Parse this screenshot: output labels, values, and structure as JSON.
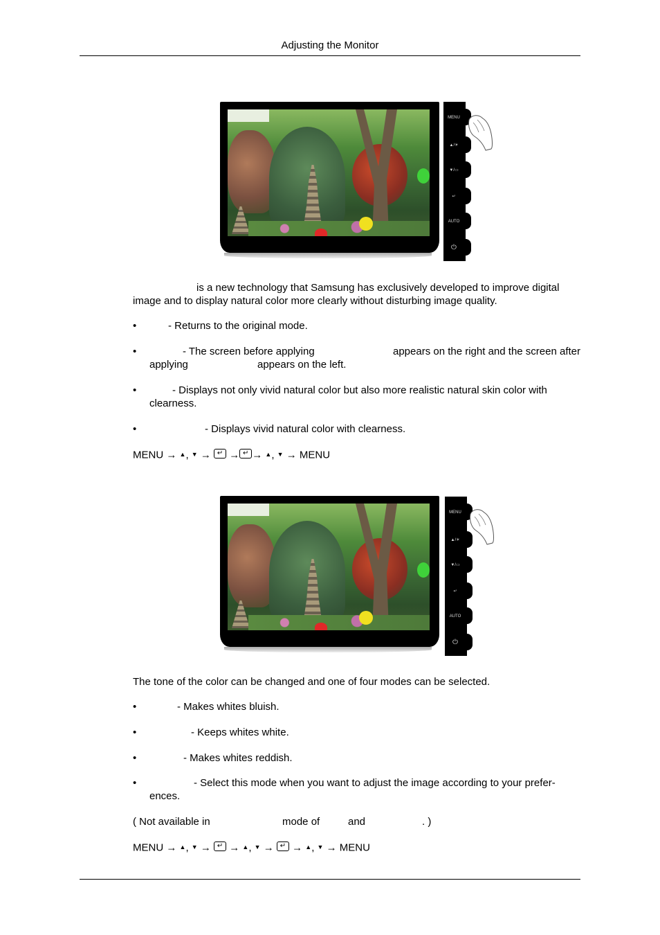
{
  "header": {
    "title": "Adjusting the Monitor"
  },
  "monitor_buttons": [
    {
      "label": "MENU",
      "icon": "menu-icon"
    },
    {
      "label": "▲/☀",
      "icon": "up-brightness-icon"
    },
    {
      "label": "▼/▭",
      "icon": "down-source-icon"
    },
    {
      "label": "↵",
      "icon": "enter-icon"
    },
    {
      "label": "AUTO",
      "icon": "auto-icon"
    },
    {
      "label": "⏻",
      "icon": "power-icon"
    }
  ],
  "section1": {
    "intro_line1": "is a new technology that Samsung has exclusively developed to improve digital",
    "intro_line2": "image and to display natural color more clearly without disturbing image quality.",
    "bullets": [
      {
        "text": "- Returns to the original mode."
      },
      {
        "text_a": "- The screen before applying",
        "text_b": "appears on the right and the screen after",
        "text_c": "applying",
        "text_d": "appears on the left."
      },
      {
        "line1": "- Displays not only vivid natural color but also more realistic natural skin color with",
        "line2": "clearness."
      },
      {
        "text": "- Displays vivid natural color with clearness."
      }
    ],
    "sequence": {
      "menu_start": "MENU",
      "arrow": "→",
      "up": "▲",
      "down": "▼",
      "comma": ",",
      "enter": "↵",
      "menu_end": "MENU"
    }
  },
  "section2": {
    "intro": "The tone of the color can be changed and one of four modes can be selected.",
    "bullets": [
      {
        "text": "- Makes whites bluish."
      },
      {
        "text": "- Keeps whites white."
      },
      {
        "text": "- Makes whites reddish."
      },
      {
        "line1": "- Select this mode when you want to adjust the image according to your prefer-",
        "line2": "ences."
      }
    ],
    "note": {
      "a": "( Not available in",
      "b": "mode of",
      "c": "and",
      "d": ". )"
    },
    "sequence": {
      "menu_start": "MENU",
      "arrow": "→",
      "up": "▲",
      "down": "▼",
      "comma": ",",
      "enter": "↵",
      "menu_end": "MENU"
    }
  },
  "bullet_char": "•"
}
